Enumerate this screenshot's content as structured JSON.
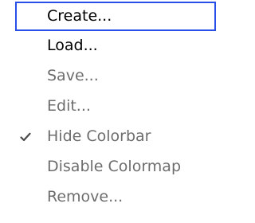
{
  "menu": {
    "items": [
      {
        "label": "Create...",
        "enabled": true,
        "selected": true,
        "checked": false
      },
      {
        "label": "Load...",
        "enabled": true,
        "selected": false,
        "checked": false
      },
      {
        "label": "Save...",
        "enabled": false,
        "selected": false,
        "checked": false
      },
      {
        "label": "Edit...",
        "enabled": false,
        "selected": false,
        "checked": false
      },
      {
        "label": "Hide Colorbar",
        "enabled": false,
        "selected": false,
        "checked": true
      },
      {
        "label": "Disable Colormap",
        "enabled": false,
        "selected": false,
        "checked": false
      },
      {
        "label": "Remove...",
        "enabled": false,
        "selected": false,
        "checked": false
      }
    ],
    "check_icon": "checkmark-icon",
    "colors": {
      "focus_border": "#2850e8",
      "enabled_text": "#000000",
      "disabled_text": "#6d6d6d",
      "check": "#4a4a4a"
    }
  }
}
